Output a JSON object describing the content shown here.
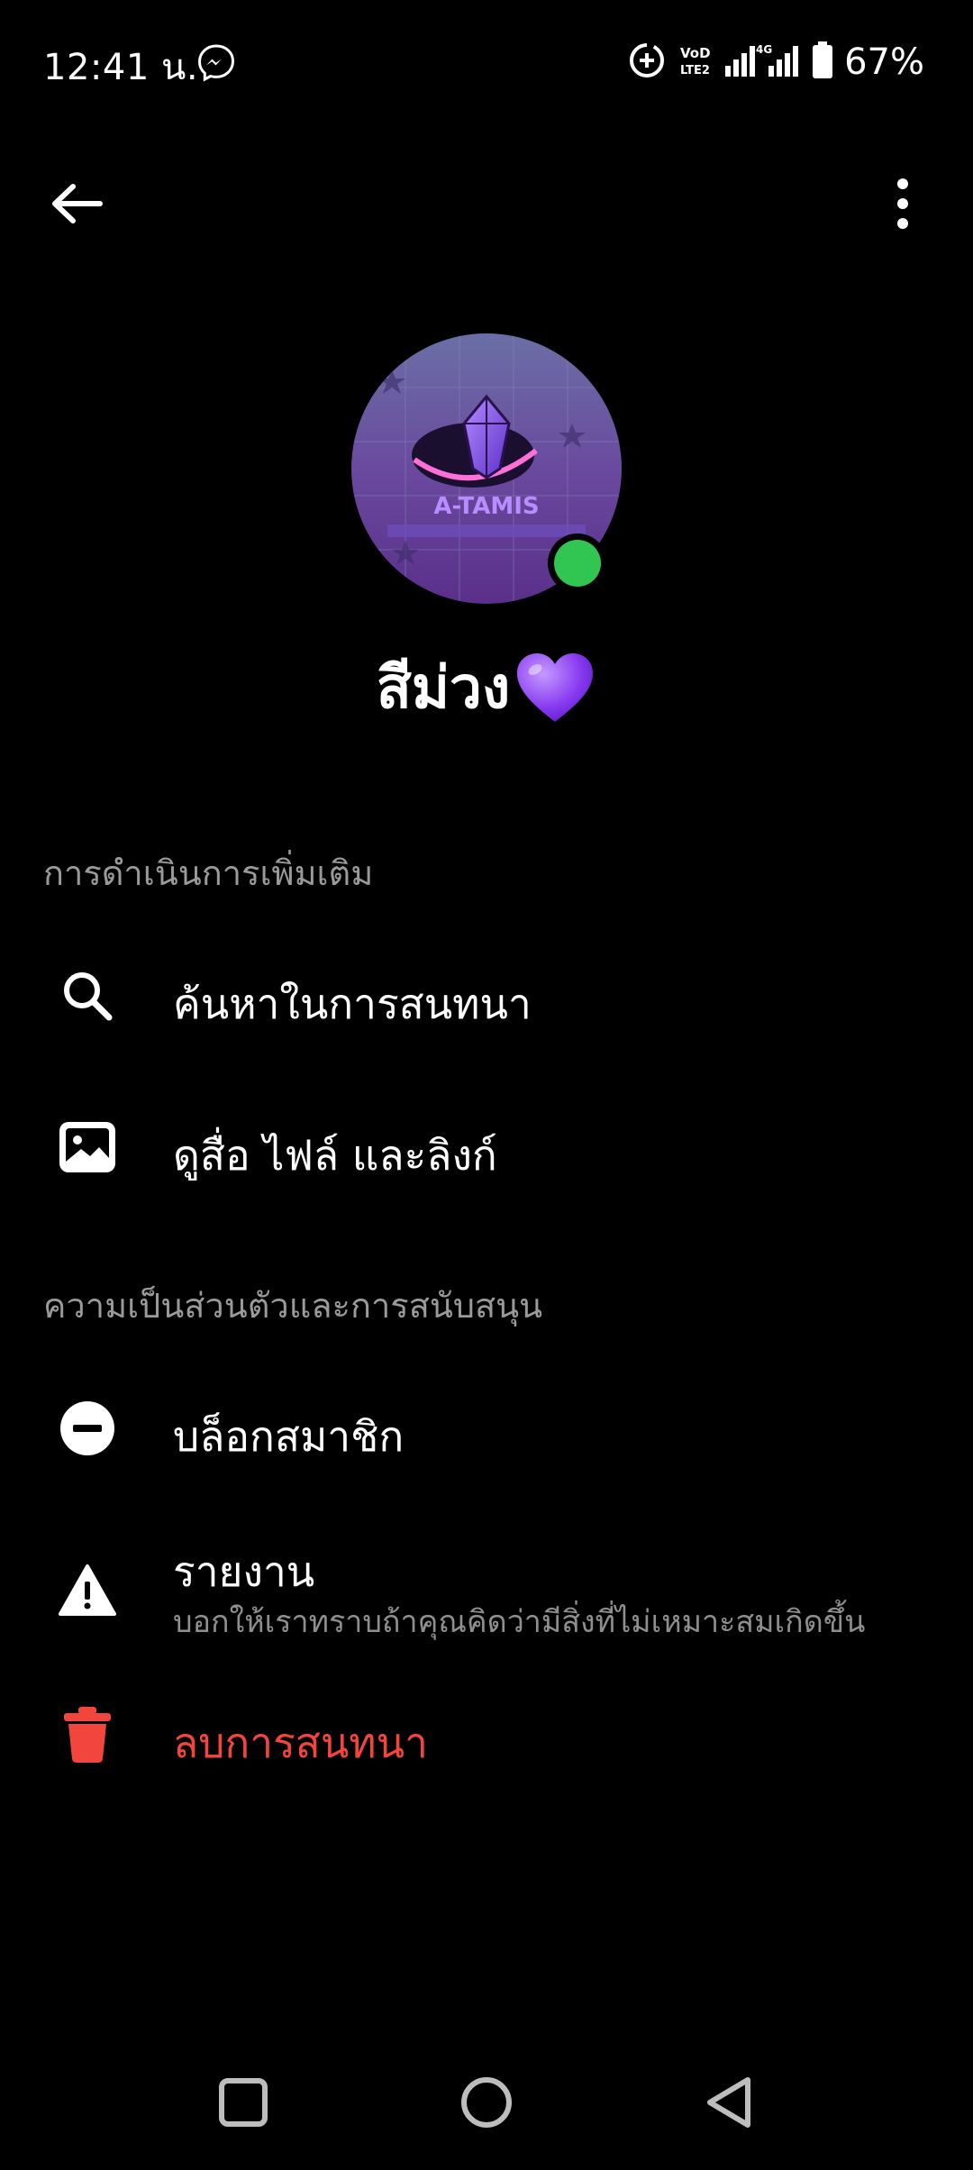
{
  "status_bar": {
    "time": "12:41 น.",
    "battery_percent": "67%",
    "icons": [
      "messenger-icon",
      "data-saver-icon",
      "volte-icon",
      "signal-icon",
      "battery-icon"
    ]
  },
  "header": {
    "back_icon": "arrow-left-icon",
    "more_icon": "vertical-dots-icon"
  },
  "profile": {
    "name": "สีม่วง",
    "name_emoji": "purple-heart",
    "avatar_text": "A-TAMIS",
    "online": true
  },
  "sections": [
    {
      "header": "การดำเนินการเพิ่มเติม",
      "items": [
        {
          "label": "ค้นหาในการสนทนา",
          "icon": "search-icon"
        },
        {
          "label": "ดูสื่อ ไฟล์ และลิงก์",
          "icon": "image-icon"
        }
      ]
    },
    {
      "header": "ความเป็นส่วนตัวและการสนับสนุน",
      "items": [
        {
          "label": "บล็อกสมาชิก",
          "icon": "block-icon"
        },
        {
          "label": "รายงาน",
          "sublabel": "บอกให้เราทราบถ้าคุณคิดว่ามีสิ่งที่ไม่เหมาะสมเกิดขึ้น",
          "icon": "warning-icon"
        },
        {
          "label": "ลบการสนทนา",
          "icon": "trash-icon",
          "color": "#f1453d"
        }
      ]
    }
  ],
  "colors": {
    "background": "#000000",
    "danger": "#f1453d",
    "online": "#31c552",
    "section_header": "#9a9a9a"
  }
}
